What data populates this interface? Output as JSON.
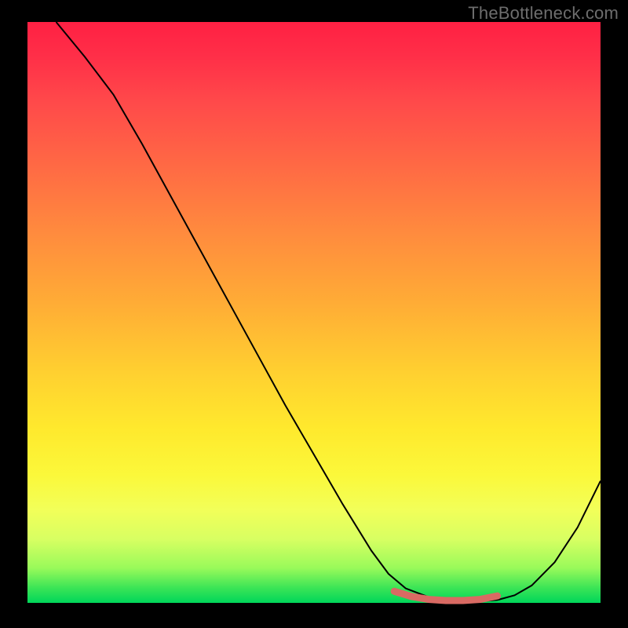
{
  "watermark": "TheBottleneck.com",
  "chart_data": {
    "type": "line",
    "title": "",
    "xlabel": "",
    "ylabel": "",
    "x_range": [
      0,
      100
    ],
    "y_range": [
      0,
      100
    ],
    "series": [
      {
        "name": "curve",
        "color": "#000000",
        "stroke_width": 2,
        "x": [
          5,
          10,
          15,
          20,
          25,
          30,
          35,
          40,
          45,
          50,
          55,
          60,
          63,
          66,
          70,
          74,
          78,
          82,
          85,
          88,
          92,
          96,
          100
        ],
        "y": [
          100,
          94,
          87.5,
          79,
          70,
          61,
          52,
          43,
          34,
          25.5,
          17,
          9,
          5,
          2.5,
          1,
          0.4,
          0.2,
          0.5,
          1.3,
          3,
          7,
          13,
          21
        ]
      },
      {
        "name": "highlight",
        "color": "#d96a63",
        "stroke_width": 9,
        "linecap": "round",
        "x": [
          64,
          67,
          70,
          73,
          76,
          79,
          82
        ],
        "y": [
          2.0,
          1.1,
          0.6,
          0.4,
          0.4,
          0.6,
          1.2
        ]
      }
    ],
    "gradient_stops": [
      {
        "pos": 0.0,
        "color": "#ff2043"
      },
      {
        "pos": 0.5,
        "color": "#ffb531"
      },
      {
        "pos": 0.8,
        "color": "#f6ff46"
      },
      {
        "pos": 1.0,
        "color": "#00d65a"
      }
    ]
  }
}
